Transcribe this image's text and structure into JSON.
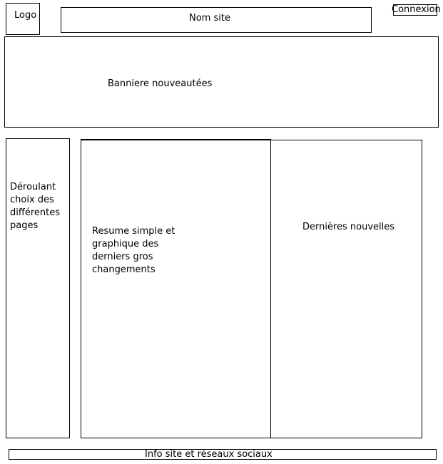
{
  "header": {
    "logo_label": "Logo",
    "site_name_label": "Nom site",
    "login_label": "Connexion"
  },
  "banner": {
    "label": "Banniere nouveautées"
  },
  "sidebar": {
    "label": "Déroulant\nchoix des\ndifférentes\npages"
  },
  "main": {
    "summary_label": "Resume simple et\ngraphique des\nderniers gros\nchangements",
    "news_label": "Dernières nouvelles"
  },
  "footer": {
    "label": "Info site et réseaux sociaux"
  }
}
